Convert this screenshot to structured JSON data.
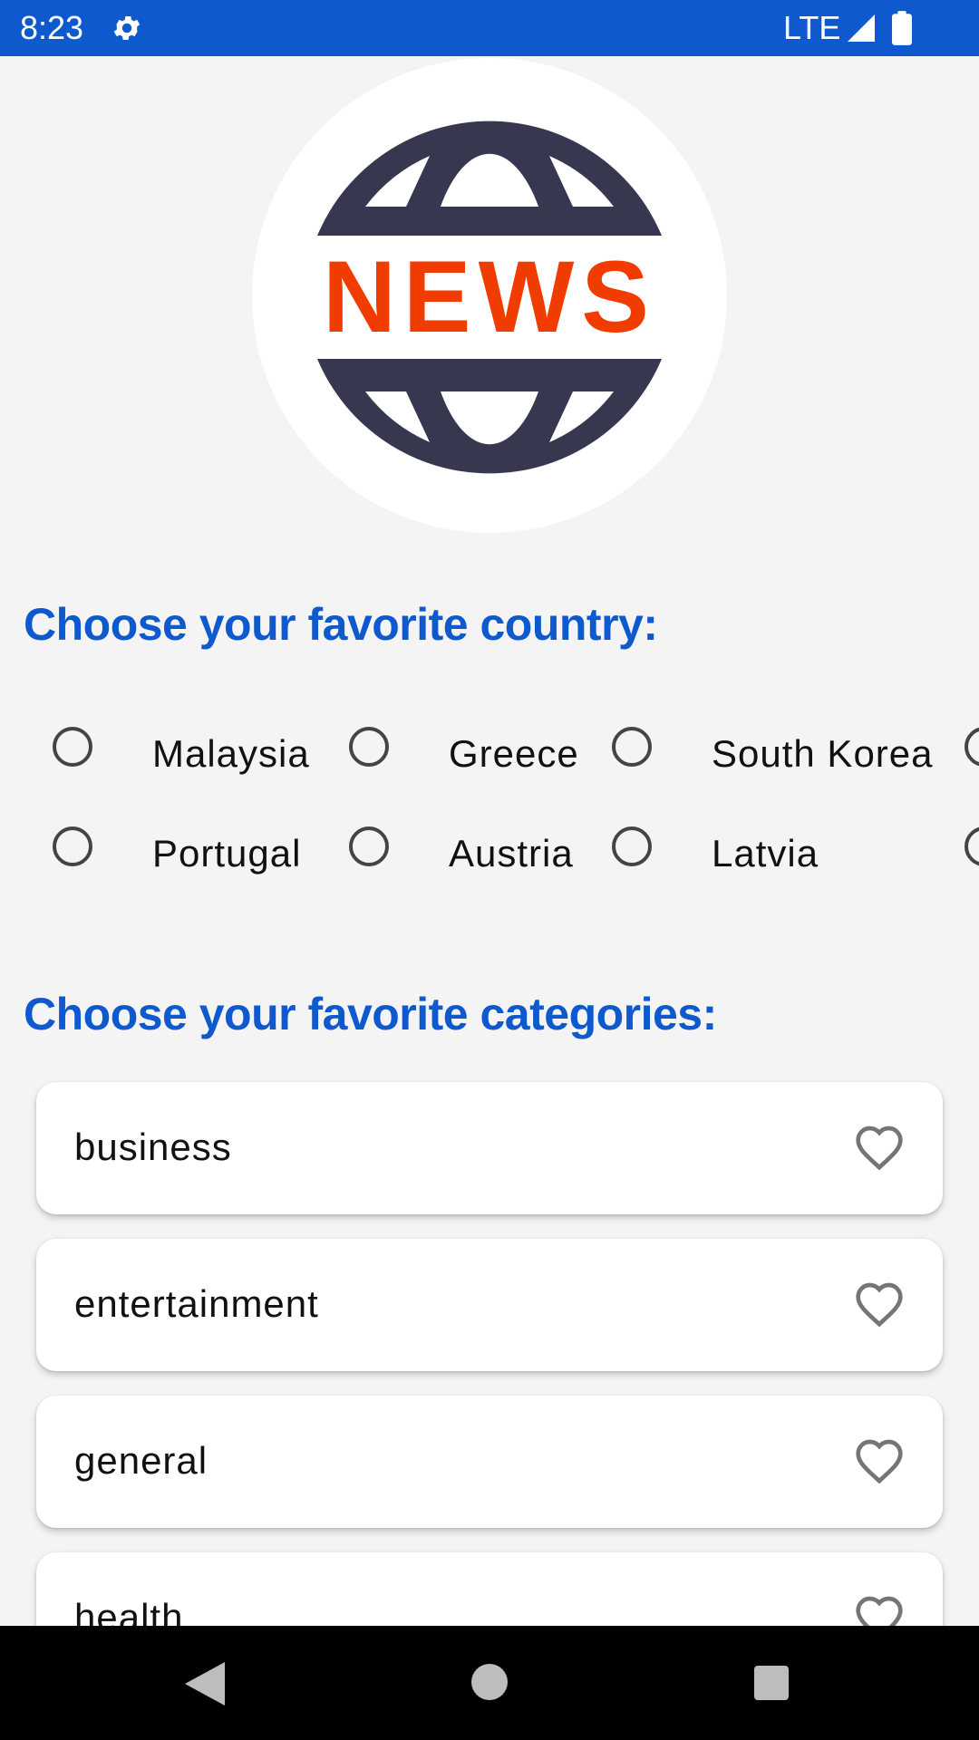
{
  "status_bar": {
    "time": "8:23",
    "network": "LTE",
    "icons": [
      "gear-icon",
      "signal-icon",
      "battery-icon"
    ],
    "background": "#0f59cf"
  },
  "logo": {
    "text": "NEWS",
    "icon": "globe-icon",
    "colors": {
      "globe": "#383750",
      "text": "#f13c00"
    }
  },
  "country_section": {
    "title": "Choose your favorite country:",
    "options": [
      {
        "label": "Malaysia",
        "selected": false
      },
      {
        "label": "Greece",
        "selected": false
      },
      {
        "label": "South Korea",
        "selected": false
      },
      {
        "label": "",
        "selected": false
      },
      {
        "label": "Portugal",
        "selected": false
      },
      {
        "label": "Austria",
        "selected": false
      },
      {
        "label": "Latvia",
        "selected": false
      },
      {
        "label": "",
        "selected": false
      }
    ]
  },
  "categories_section": {
    "title": "Choose your favorite categories:",
    "items": [
      {
        "label": "business",
        "favorite": false
      },
      {
        "label": "entertainment",
        "favorite": false
      },
      {
        "label": "general",
        "favorite": false
      },
      {
        "label": "health",
        "favorite": false
      }
    ]
  },
  "nav_bar": {
    "icons": [
      "back-icon",
      "home-icon",
      "recents-icon"
    ]
  },
  "colors": {
    "accent": "#0f59cf",
    "background": "#f4f4f4"
  }
}
